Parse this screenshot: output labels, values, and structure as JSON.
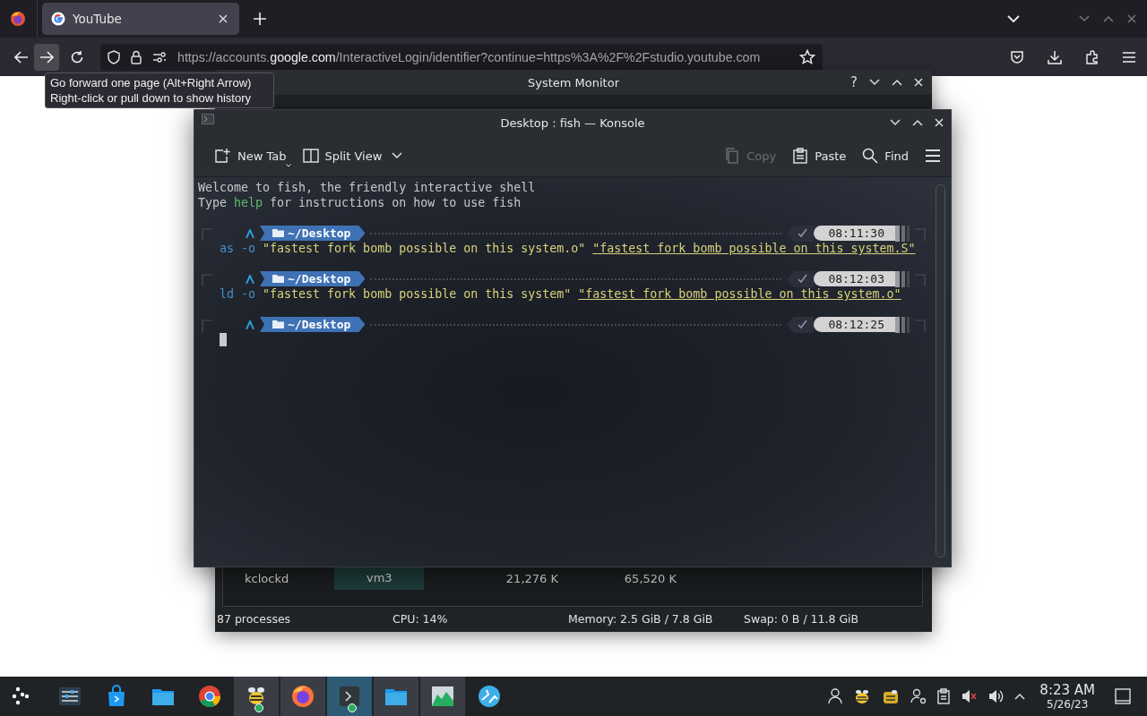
{
  "browser": {
    "tabs": [
      {
        "title": "YouTube",
        "selected": true
      }
    ],
    "url": {
      "start": "https://accounts.",
      "domain": "google.com",
      "rest": "/InteractiveLogin/identifier?continue=https%3A%2F%2Fstudio.youtube.com"
    },
    "tooltip": [
      "Go forward one page (Alt+Right Arrow)",
      "Right-click or pull down to show history"
    ]
  },
  "system_monitor": {
    "title": "System Monitor",
    "help_button": "?",
    "process_row": [
      "kclockd",
      "vm3",
      "21,276 K",
      "65,520 K"
    ],
    "status_bar": [
      "87 processes",
      "CPU: 14%",
      "Memory: 2.5 GiB / 7.8 GiB",
      "Swap: 0 B / 11.8 GiB"
    ]
  },
  "konsole": {
    "title": "Desktop : fish — Konsole",
    "toolbar": [
      {
        "kind": "new-tab",
        "label": "New Tab",
        "disabled": false
      },
      {
        "kind": "split",
        "label": "Split View",
        "disabled": false
      },
      {
        "kind": "copy",
        "label": "Copy",
        "disabled": true
      },
      {
        "kind": "paste",
        "label": "Paste",
        "disabled": false
      },
      {
        "kind": "find",
        "label": "Find",
        "disabled": false
      }
    ],
    "welcome": "Welcome to fish, the friendly interactive shell",
    "help_line": {
      "before": "Type ",
      "keyword": "help",
      "after": " for instructions on how to use fish"
    },
    "prompts": [
      {
        "path": "~/Desktop",
        "time": "08:11:30",
        "command": {
          "program": "as",
          "flag": "-o",
          "args": [
            {
              "text": "\"fastest fork bomb possible on this system.o\"",
              "underlined": false
            },
            {
              "text": "\"fastest fork bomb possible on this system.S\"",
              "underlined": true
            }
          ]
        }
      },
      {
        "path": "~/Desktop",
        "time": "08:12:03",
        "command": {
          "program": "ld",
          "flag": "-o",
          "args": [
            {
              "text": "\"fastest fork bomb possible on this system\"",
              "underlined": false
            },
            {
              "text": "\"fastest fork bomb possible on this system.o\"",
              "underlined": true
            }
          ]
        }
      },
      {
        "path": "~/Desktop",
        "time": "08:12:25"
      }
    ]
  },
  "taskbar": {
    "apps": [
      {
        "kind": "launcher",
        "running": false,
        "selected": false
      },
      {
        "kind": "mixer",
        "running": false,
        "selected": false
      },
      {
        "kind": "store",
        "running": false,
        "selected": false
      },
      {
        "kind": "folder",
        "running": false,
        "selected": false
      },
      {
        "kind": "chrome",
        "running": false,
        "selected": false
      },
      {
        "kind": "bee",
        "running": true,
        "selected": false
      },
      {
        "kind": "firefox",
        "running": true,
        "selected": false
      },
      {
        "kind": "terminal",
        "running": true,
        "selected": true
      },
      {
        "kind": "folder",
        "running": true,
        "selected": false
      },
      {
        "kind": "monitor",
        "running": true,
        "selected": false
      },
      {
        "kind": "globe",
        "running": false,
        "selected": false
      }
    ],
    "time": "8:23 AM",
    "date": "5/26/23"
  }
}
